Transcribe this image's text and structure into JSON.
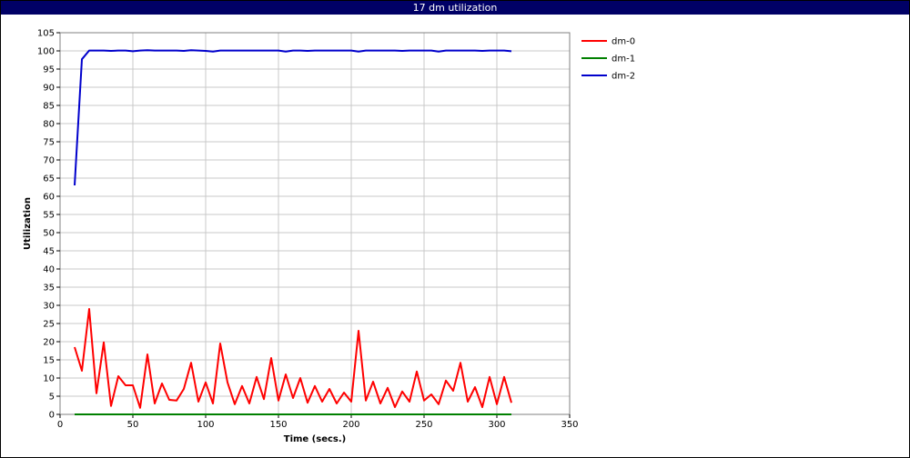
{
  "window": {
    "title": "17 dm utilization"
  },
  "chart_data": {
    "type": "line",
    "title": "17 dm utilization",
    "xlabel": "Time (secs.)",
    "ylabel": "Utilization",
    "xlim": [
      0,
      350
    ],
    "ylim": [
      0,
      105
    ],
    "xticks": [
      0,
      50,
      100,
      150,
      200,
      250,
      300,
      350
    ],
    "yticks": [
      0,
      5,
      10,
      15,
      20,
      25,
      30,
      35,
      40,
      45,
      50,
      55,
      60,
      65,
      70,
      75,
      80,
      85,
      90,
      95,
      100,
      105
    ],
    "grid": true,
    "legend_position": "top-right outside",
    "x": [
      10,
      15,
      20,
      25,
      30,
      35,
      40,
      45,
      50,
      55,
      60,
      65,
      70,
      75,
      80,
      85,
      90,
      95,
      100,
      105,
      110,
      115,
      120,
      125,
      130,
      135,
      140,
      145,
      150,
      155,
      160,
      165,
      170,
      175,
      180,
      185,
      190,
      195,
      200,
      205,
      210,
      215,
      220,
      225,
      230,
      235,
      240,
      245,
      250,
      255,
      260,
      265,
      270,
      275,
      280,
      285,
      290,
      295,
      300,
      305,
      310
    ],
    "series": [
      {
        "name": "dm-0",
        "color": "#ff0000",
        "values": [
          18.5,
          12,
          29,
          5.8,
          19.8,
          2.3,
          10.5,
          8,
          8,
          1.8,
          16.5,
          3,
          8.5,
          4,
          3.8,
          7,
          14.2,
          3.5,
          8.8,
          3,
          19.5,
          8.8,
          2.8,
          7.8,
          3,
          10.3,
          4.2,
          15.5,
          3.8,
          11,
          4.5,
          10,
          3.2,
          7.8,
          3.5,
          7,
          3,
          6,
          3.5,
          23,
          3.8,
          9,
          3,
          7.3,
          2,
          6.3,
          3.5,
          11.8,
          3.8,
          5.5,
          2.8,
          9.3,
          6.5,
          14.2,
          3.5,
          7.5,
          2,
          10.3,
          2.8,
          10.3,
          3.2
        ]
      },
      {
        "name": "dm-1",
        "color": "#008000",
        "values": [
          0,
          0,
          0,
          0,
          0,
          0,
          0,
          0,
          0,
          0,
          0,
          0,
          0,
          0,
          0,
          0,
          0,
          0,
          0,
          0,
          0,
          0,
          0,
          0,
          0,
          0,
          0,
          0,
          0,
          0,
          0,
          0,
          0,
          0,
          0,
          0,
          0,
          0,
          0,
          0,
          0,
          0,
          0,
          0,
          0,
          0,
          0,
          0,
          0,
          0,
          0,
          0,
          0,
          0,
          0,
          0,
          0,
          0,
          0,
          0,
          0
        ]
      },
      {
        "name": "dm-2",
        "color": "#0000cc",
        "values": [
          63,
          97.7,
          100.1,
          100.1,
          100.1,
          100,
          100.1,
          100.1,
          99.9,
          100.1,
          100.2,
          100.1,
          100.1,
          100.1,
          100.1,
          100,
          100.2,
          100.1,
          100,
          99.8,
          100.1,
          100.1,
          100.1,
          100.1,
          100.1,
          100.1,
          100.1,
          100.1,
          100.1,
          99.8,
          100.1,
          100.1,
          100,
          100.1,
          100.1,
          100.1,
          100.1,
          100.1,
          100.1,
          99.8,
          100.1,
          100.1,
          100.1,
          100.1,
          100.1,
          100,
          100.1,
          100.1,
          100.1,
          100.1,
          99.8,
          100.1,
          100.1,
          100.1,
          100.1,
          100.1,
          100,
          100.1,
          100.1,
          100.1,
          99.9
        ]
      }
    ]
  }
}
